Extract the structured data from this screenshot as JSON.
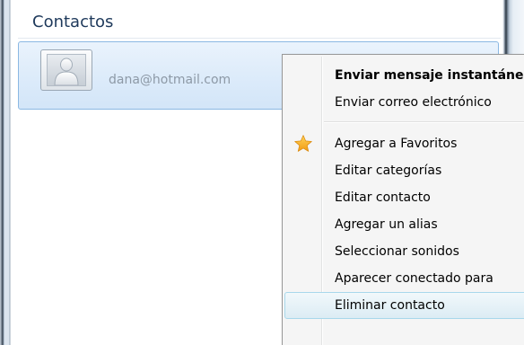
{
  "contacts": {
    "header": "Contactos",
    "items": [
      {
        "email": "dana@hotmail.com",
        "avatar_icon": "default-user-avatar-icon"
      }
    ]
  },
  "context_menu": {
    "items": [
      {
        "label": "Enviar mensaje instantáneo",
        "bold": true
      },
      {
        "label": "Enviar correo electrónico"
      },
      {
        "label": "Agregar a Favoritos",
        "icon": "star-icon",
        "icon_color": "#f5a623"
      },
      {
        "label": "Editar categorías"
      },
      {
        "label": "Editar contacto"
      },
      {
        "label": "Agregar un alias"
      },
      {
        "label": "Seleccionar sonidos"
      },
      {
        "label": "Aparecer conectado para"
      },
      {
        "label": "Eliminar contacto",
        "highlighted": true
      }
    ]
  },
  "colors": {
    "header_text": "#1e395b",
    "selection_border": "#8bb8e3",
    "menu_highlight_border": "#a8d8eb"
  }
}
